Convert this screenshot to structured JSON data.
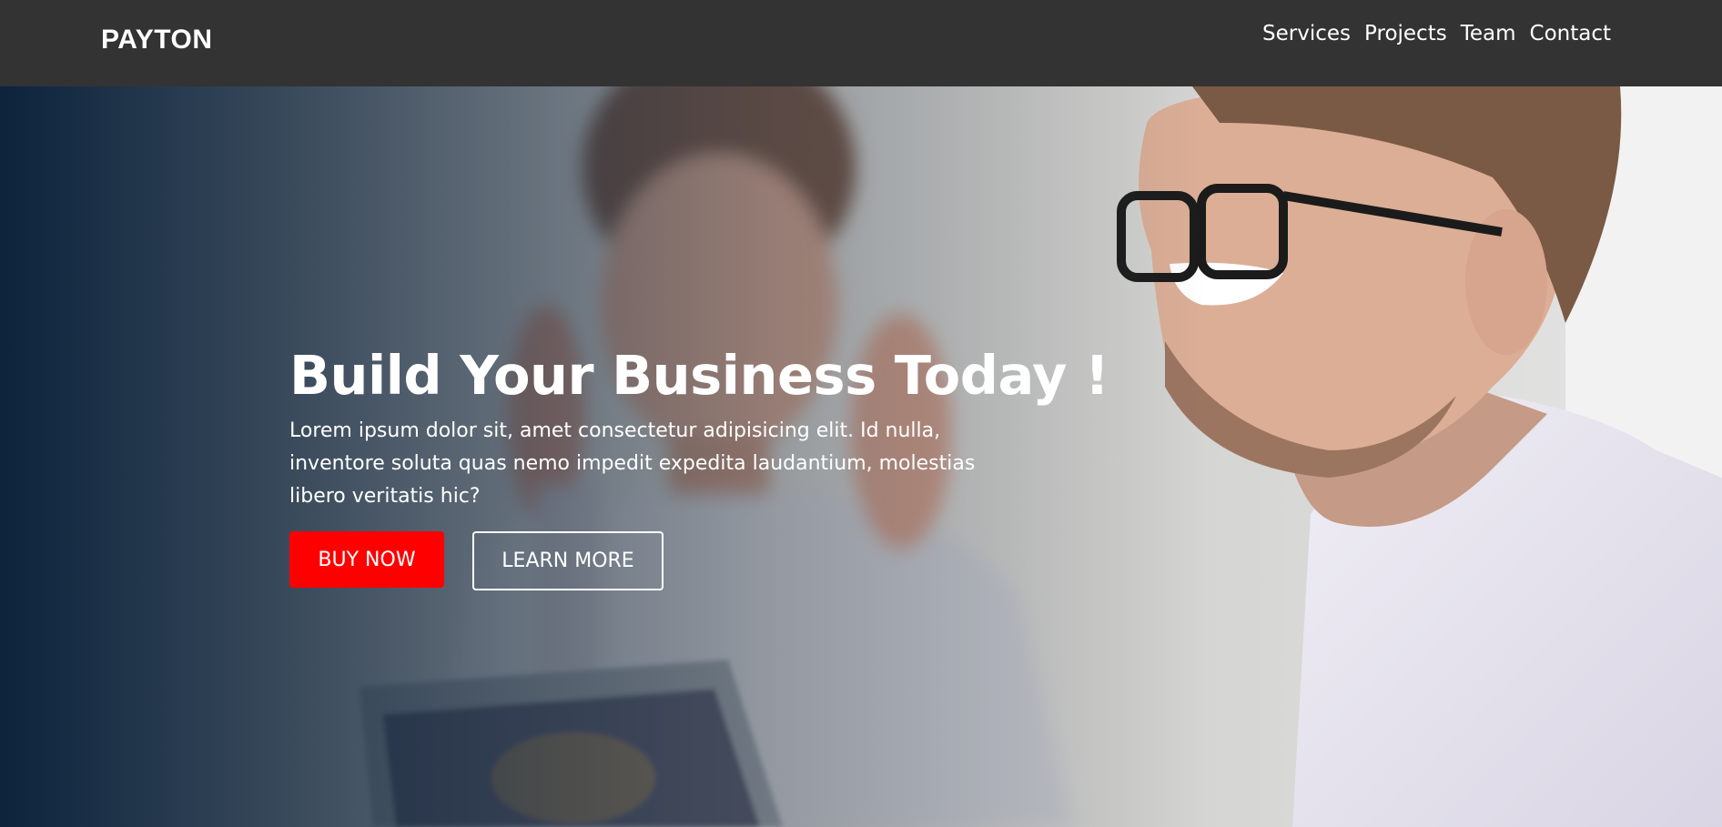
{
  "brand": {
    "logo_text": "PAYTON"
  },
  "nav": {
    "items": [
      {
        "label": "Services"
      },
      {
        "label": "Projects"
      },
      {
        "label": "Team"
      },
      {
        "label": "Contact"
      }
    ]
  },
  "hero": {
    "title": "Build Your Business Today !",
    "text": "Lorem ipsum dolor sit, amet consectetur adipisicing elit. Id nulla, inventore soluta quas nemo impedit expedita laudantium, molestias libero veritatis hic?",
    "primary_button": "BUY NOW",
    "secondary_button": "LEARN MORE"
  },
  "colors": {
    "navbar_bg": "#333333",
    "primary_button": "#ff0000",
    "text": "#ffffff"
  }
}
